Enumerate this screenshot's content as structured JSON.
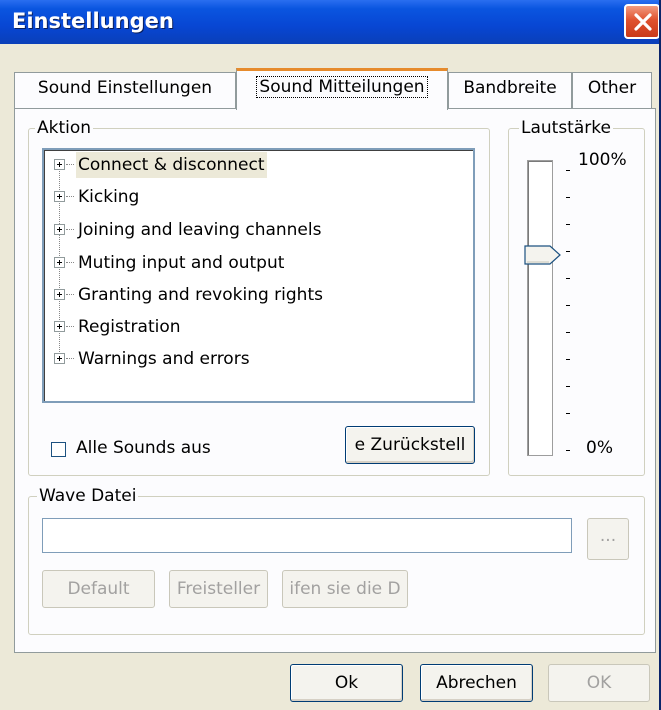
{
  "window": {
    "title": "Einstellungen"
  },
  "tabs": [
    {
      "label": "Sound Einstellungen"
    },
    {
      "label": "Sound Mitteilungen"
    },
    {
      "label": "Bandbreite"
    },
    {
      "label": "Other"
    }
  ],
  "active_tab": "Sound Mitteilungen",
  "aktion": {
    "group_label": "Aktion",
    "tree_items": [
      {
        "label": "Connect & disconnect",
        "selected": true
      },
      {
        "label": "Kicking"
      },
      {
        "label": "Joining and leaving  channels"
      },
      {
        "label": "Muting input and output"
      },
      {
        "label": "Granting and revoking rights"
      },
      {
        "label": "Registration"
      },
      {
        "label": "Warnings and errors"
      }
    ],
    "mute_all_label": "Alle Sounds aus",
    "mute_all_checked": false,
    "reset_button": "e Zurückstell"
  },
  "lautstarke": {
    "group_label": "Lautstärke",
    "max_label": "100%",
    "min_label": "0%",
    "value_percent": 70
  },
  "wave": {
    "group_label": "Wave Datei",
    "path_value": "",
    "browse_label": "...",
    "default_button": "Default",
    "freistellen_button": "Freisteller",
    "test_button": "ifen sie die D"
  },
  "footer": {
    "ok_button": "Ok",
    "cancel_button": "Abrechen",
    "apply_button": "OK"
  },
  "colors": {
    "title_bar": "#0846d3",
    "window_bg": "#ece9d8",
    "tab_panel_bg": "#fcfcfe",
    "active_tab_accent": "#e68b2c",
    "close_button": "#e0522f"
  }
}
